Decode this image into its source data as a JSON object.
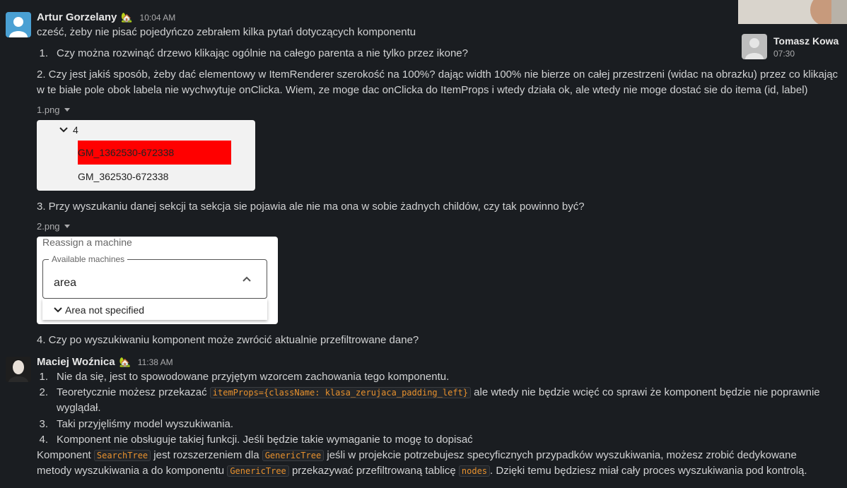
{
  "messages": {
    "artur": {
      "author": "Artur Gorzelany",
      "status_emoji": "🏡",
      "time": "10:04 AM",
      "intro": "cześć, żeby nie pisać pojedyńczo zebrałem kilka pytań dotyczących komponentu",
      "q1_num": "1.",
      "q1": "Czy można rozwinąć drzewo klikając ogólnie na całego parenta a nie tylko przez ikone?",
      "q2": "2. Czy jest jakiś sposób, żeby dać elementowy w ItemRenderer szerokość na 100%? dając width 100% nie bierze on całej przestrzeni (widac na obrazku) przez co klikając w te białe pole obok labela nie wychwytuje onClicka. Wiem, ze moge dac onClicka do ItemProps i wtedy działa ok, ale wtedy nie moge dostać sie do itema (id, label)",
      "file1": "1.png",
      "q3": "3. Przy wyszukaniu danej sekcji ta sekcja sie pojawia ale nie ma ona w sobie żadnych childów, czy tak powinno być?",
      "file2": "2.png",
      "q4": "4. Czy po wyszukiwaniu komponent może zwrócić aktualnie przefiltrowane dane?"
    },
    "maciej": {
      "author": "Maciej Woźnica",
      "status_emoji": "🏡",
      "time": "11:38 AM",
      "a1_num": "1.",
      "a1": "Nie da się, jest to spowodowane przyjętym wzorcem zachowania tego komponentu.",
      "a2_num": "2.",
      "a2_pre": "Teoretycznie możesz przekazać ",
      "a2_code": "itemProps={className: klasa_zerujaca_padding_left}",
      "a2_post": " ale wtedy nie będzie wcięć co sprawi że komponent będzie nie poprawnie wyglądał.",
      "a3_num": "3.",
      "a3": "Taki przyjęliśmy model wyszukiwania.",
      "a4_num": "4.",
      "a4": "Komponent nie obsługuje takiej funkcji. Jeśli będzie takie wymaganie to mogę to dopisać",
      "p_1": "Komponent ",
      "p_code1": "SearchTree",
      "p_2": " jest rozszerzeniem dla ",
      "p_code2": "GenericTree",
      "p_3": " jeśli w projekcie potrzebujesz specyficznych przypadków wyszukiwania, możesz zrobić dedykowane metody wyszukiwania a do komponentu ",
      "p_code3": "GenericTree",
      "p_4": " przekazywać przefiltrowaną tablicę ",
      "p_code4": "nodes",
      "p_5": ". Dzięki temu będziesz miał cały proces wyszukiwania pod kontrolą."
    }
  },
  "image1": {
    "parent_label": "4",
    "item_highlighted": "GM_1362530-672338",
    "item_plain": "GM_362530-672338",
    "highlight_color": "#ff0000"
  },
  "image2": {
    "title": "Reassign a machine",
    "field_legend": "Available machines",
    "field_value": "area",
    "option": "Area not specified"
  },
  "call": {
    "participant": "Tomasz Kowa",
    "duration": "07:30"
  }
}
